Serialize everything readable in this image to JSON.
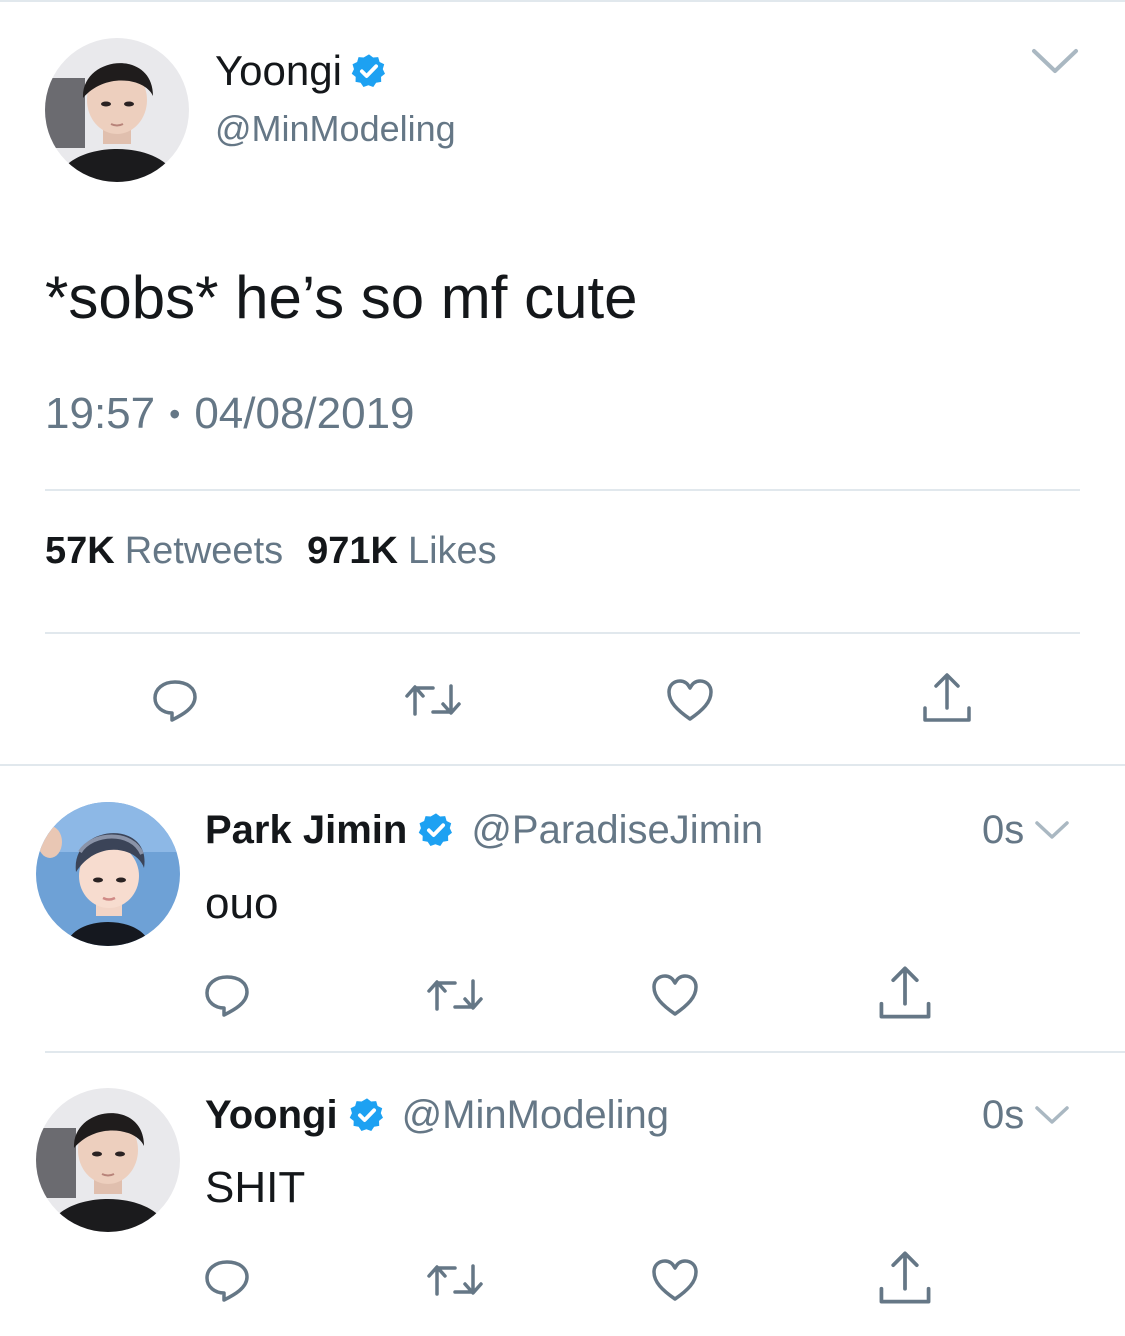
{
  "main_tweet": {
    "author_name": "Yoongi",
    "author_handle": "@MinModeling",
    "verified_icon": "verified-badge-icon",
    "text": "*sobs* he’s so mf cute",
    "time": "19:57",
    "separator": "•",
    "date": "04/08/2019",
    "retweet_count": "57K",
    "retweet_label": "Retweets",
    "like_count": "971K",
    "like_label": "Likes"
  },
  "replies": [
    {
      "author_name": "Park Jimin",
      "author_handle": "@ParadiseJimin",
      "time": "0s",
      "text": "ouo"
    },
    {
      "author_name": "Yoongi",
      "author_handle": "@MinModeling",
      "time": "0s",
      "text": "SHIT"
    }
  ],
  "icons": [
    "reply-icon",
    "retweet-icon",
    "like-icon",
    "share-icon",
    "chevron-down-icon",
    "verified-badge-icon"
  ],
  "colors": {
    "verified_blue": "#1da1f2",
    "text_primary": "#14171a",
    "text_secondary": "#657786",
    "divider": "#e1e8ed"
  }
}
